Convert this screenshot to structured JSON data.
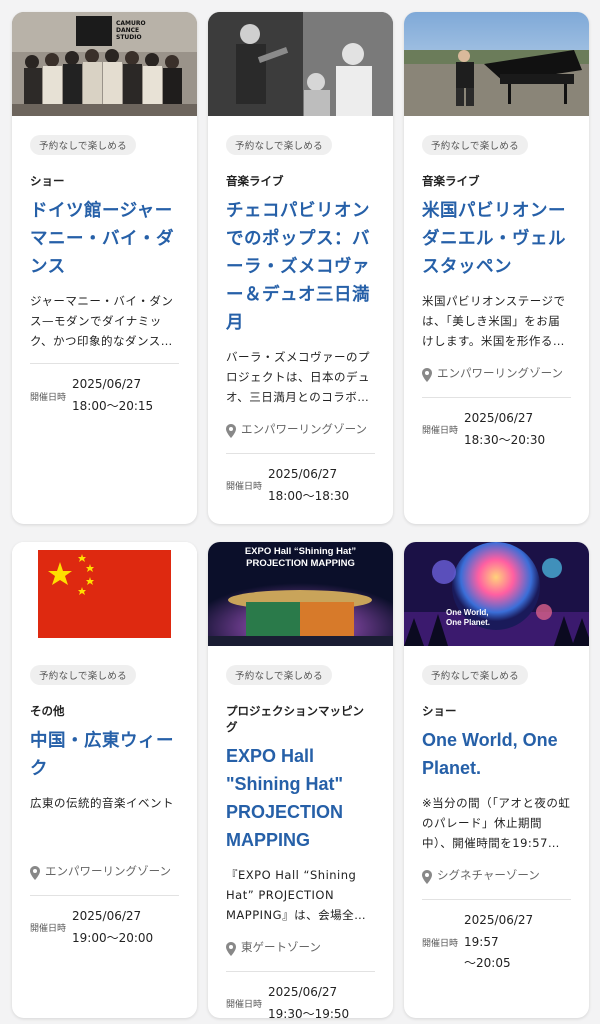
{
  "cards": [
    {
      "badge": "予約なしで楽しめる",
      "category": "ショー",
      "title": "ドイツ館ージャーマニー・バイ・ダンス",
      "description": "ジャーマニー・バイ・ダンス—モダンでダイナミック、かつ印象的なダンス…",
      "location": "",
      "date_label": "開催日時",
      "date": "2025/06/27",
      "time": "18:00～20:15",
      "thumb_text": "CAMURO DANCE STUDIO"
    },
    {
      "badge": "予約なしで楽しめる",
      "category": "音楽ライブ",
      "title": "チェコパビリオンでのポップス：バーラ・ズメコヴァー＆デュオ三日満月",
      "description": "バーラ・ズメコヴァーのプロジェクトは、日本のデュオ、三日満月とのコラボ…",
      "location": "エンパワーリングゾーン",
      "date_label": "開催日時",
      "date": "2025/06/27",
      "time": "18:00～18:30"
    },
    {
      "badge": "予約なしで楽しめる",
      "category": "音楽ライブ",
      "title": "米国パビリオンー ダニエル・ヴェルスタッペン",
      "description": "米国パビリオンステージでは、「美しき米国」をお届けします。米国を形作る…",
      "location": "エンパワーリングゾーン",
      "date_label": "開催日時",
      "date": "2025/06/27",
      "time": "18:30～20:30"
    },
    {
      "badge": "予約なしで楽しめる",
      "category": "その他",
      "title": "中国・広東ウィーク",
      "description": "広東の伝統的音楽イベント",
      "location": "エンパワーリングゾーン",
      "date_label": "開催日時",
      "date": "2025/06/27",
      "time": "19:00～20:00"
    },
    {
      "badge": "予約なしで楽しめる",
      "category": "プロジェクションマッピング",
      "title": "EXPO Hall \"Shining Hat\" PROJECTION MAPPING",
      "description": "『EXPO Hall “Shining Hat” PROJECTION MAPPING』は、会場全体のシンボル…",
      "location": "東ゲートゾーン",
      "date_label": "開催日時",
      "date": "2025/06/27",
      "time": "19:30～19:50",
      "thumb_text": "EXPO Hall “Shining Hat” PROJECTION MAPPING"
    },
    {
      "badge": "予約なしで楽しめる",
      "category": "ショー",
      "title": "One World, One Planet.",
      "description": "※当分の間（「アオと夜の虹のパレード」休止期間中）、開催時間を19:57…",
      "location": "シグネチャーゾーン",
      "date_label": "開催日時",
      "date": "2025/06/27 19:57",
      "time": "～20:05",
      "thumb_text": "One World, One Planet."
    }
  ],
  "colors": {
    "title": "#2660a8",
    "background": "#f3f3f4",
    "card": "#ffffff"
  }
}
